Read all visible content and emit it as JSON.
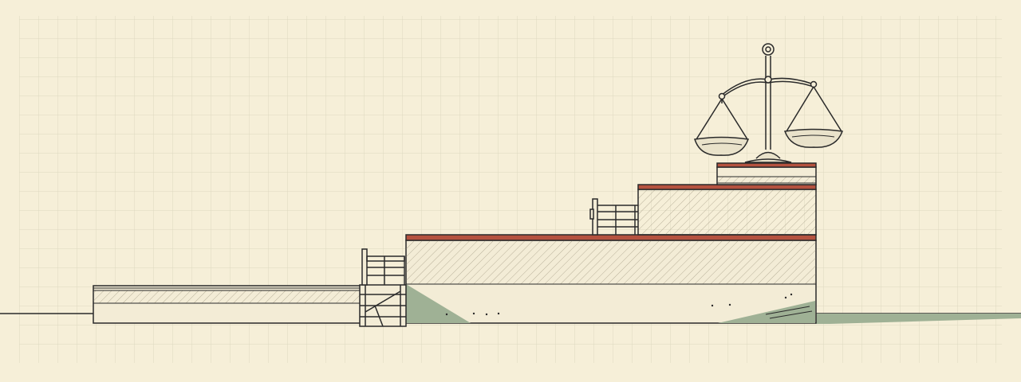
{
  "scene": {
    "subject": "scales-of-justice-on-stepped-platform",
    "style": "line-drawing-on-grid-paper",
    "text_present": false
  },
  "colors": {
    "paper": "#f6efd8",
    "grid": "#e0dcc6",
    "ink": "#2a2a2a",
    "terracotta": "#b5523f",
    "sage_shadow": "#9fb195",
    "hatch": "#b9b19a",
    "wood": "#f3ecd6"
  },
  "icons": [
    "scales-of-justice-icon",
    "ladder-icon",
    "railing-icon"
  ]
}
